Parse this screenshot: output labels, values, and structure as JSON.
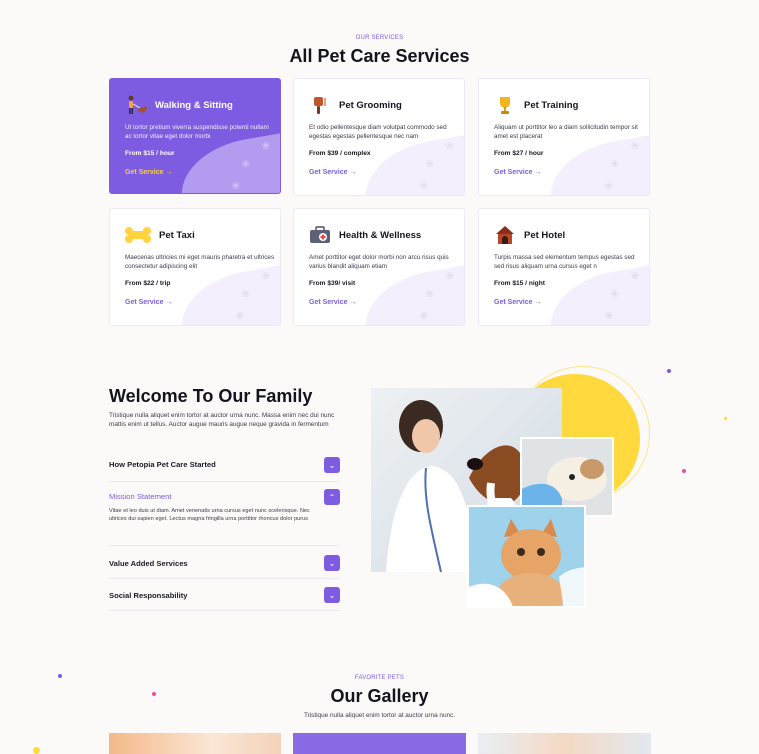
{
  "services": {
    "eyebrow": "OUR SERVICES",
    "heading": "All Pet Care Services",
    "cards": [
      {
        "title": "Walking & Sitting",
        "desc": "Ut tortor pretium viverra suspendisse potenti nullam ac tortor vitae eget dolor morbi",
        "price": "From $15 / hour",
        "link": "Get Service →",
        "icon": "dog-walker-icon",
        "active": true
      },
      {
        "title": "Pet Grooming",
        "desc": "Et odio pellentesque diam volutpat commodo sed egestas egestas pellentesque nec nam",
        "price": "From $39 / complex",
        "link": "Get Service →",
        "icon": "grooming-brush-icon",
        "active": false
      },
      {
        "title": "Pet Training",
        "desc": "Aliquam ut porttitor leo a diam sollicitudin tempor sit amet est placerat",
        "price": "From $27 / hour",
        "link": "Get Service →",
        "icon": "trophy-icon",
        "active": false
      },
      {
        "title": "Pet Taxi",
        "desc": "Maecenas ultricies mi eget mauris pharetra et ultrices consectetur adipiscing elit",
        "price": "From $22 / trip",
        "link": "Get Service →",
        "icon": "bone-icon",
        "active": false
      },
      {
        "title": "Health & Wellness",
        "desc": "Amet porttitor eget dolor morbi non arcu risus quis varius blandit aliquam etiam",
        "price": "From $39/ visit",
        "link": "Get Service →",
        "icon": "medical-kit-icon",
        "active": false
      },
      {
        "title": "Pet Hotel",
        "desc": "Turpis massa sed elementum tempus egestas sed sed risus aliquam urna cursus eget n",
        "price": "From $15 / night",
        "link": "Get Service →",
        "icon": "doghouse-icon",
        "active": false
      }
    ]
  },
  "welcome": {
    "heading": "Welcome To Our Family",
    "intro": "Tristique nulla aliquet enim tortor at auctor urna nunc. Massa enim nec dui nunc mattis enim ut tellus. Auctor augue mauris augue neque gravida in fermentum",
    "accordion": [
      {
        "title": "How Petopia Pet Care Started",
        "open": false
      },
      {
        "title": "Mission Statement",
        "open": true,
        "body": "Vitae et leo duis ut diam. Amet venenatis urna cursus eget nunc scelerisque. Nec ultrices dui sapien eget. Lectus magna fringilla urna porttitor rhoncus dolor purus"
      },
      {
        "title": "Value Added Services",
        "open": false
      },
      {
        "title": "Social Responsability",
        "open": false
      }
    ]
  },
  "gallery": {
    "eyebrow": "FAVORITE PETS",
    "heading": "Our Gallery",
    "subtitle": "Tristique nulla aliquet enim tortor at auctor urna nunc."
  },
  "colors": {
    "accent": "#7d5ce2",
    "yellow": "#ffd93d",
    "pink": "#f24aa3"
  }
}
